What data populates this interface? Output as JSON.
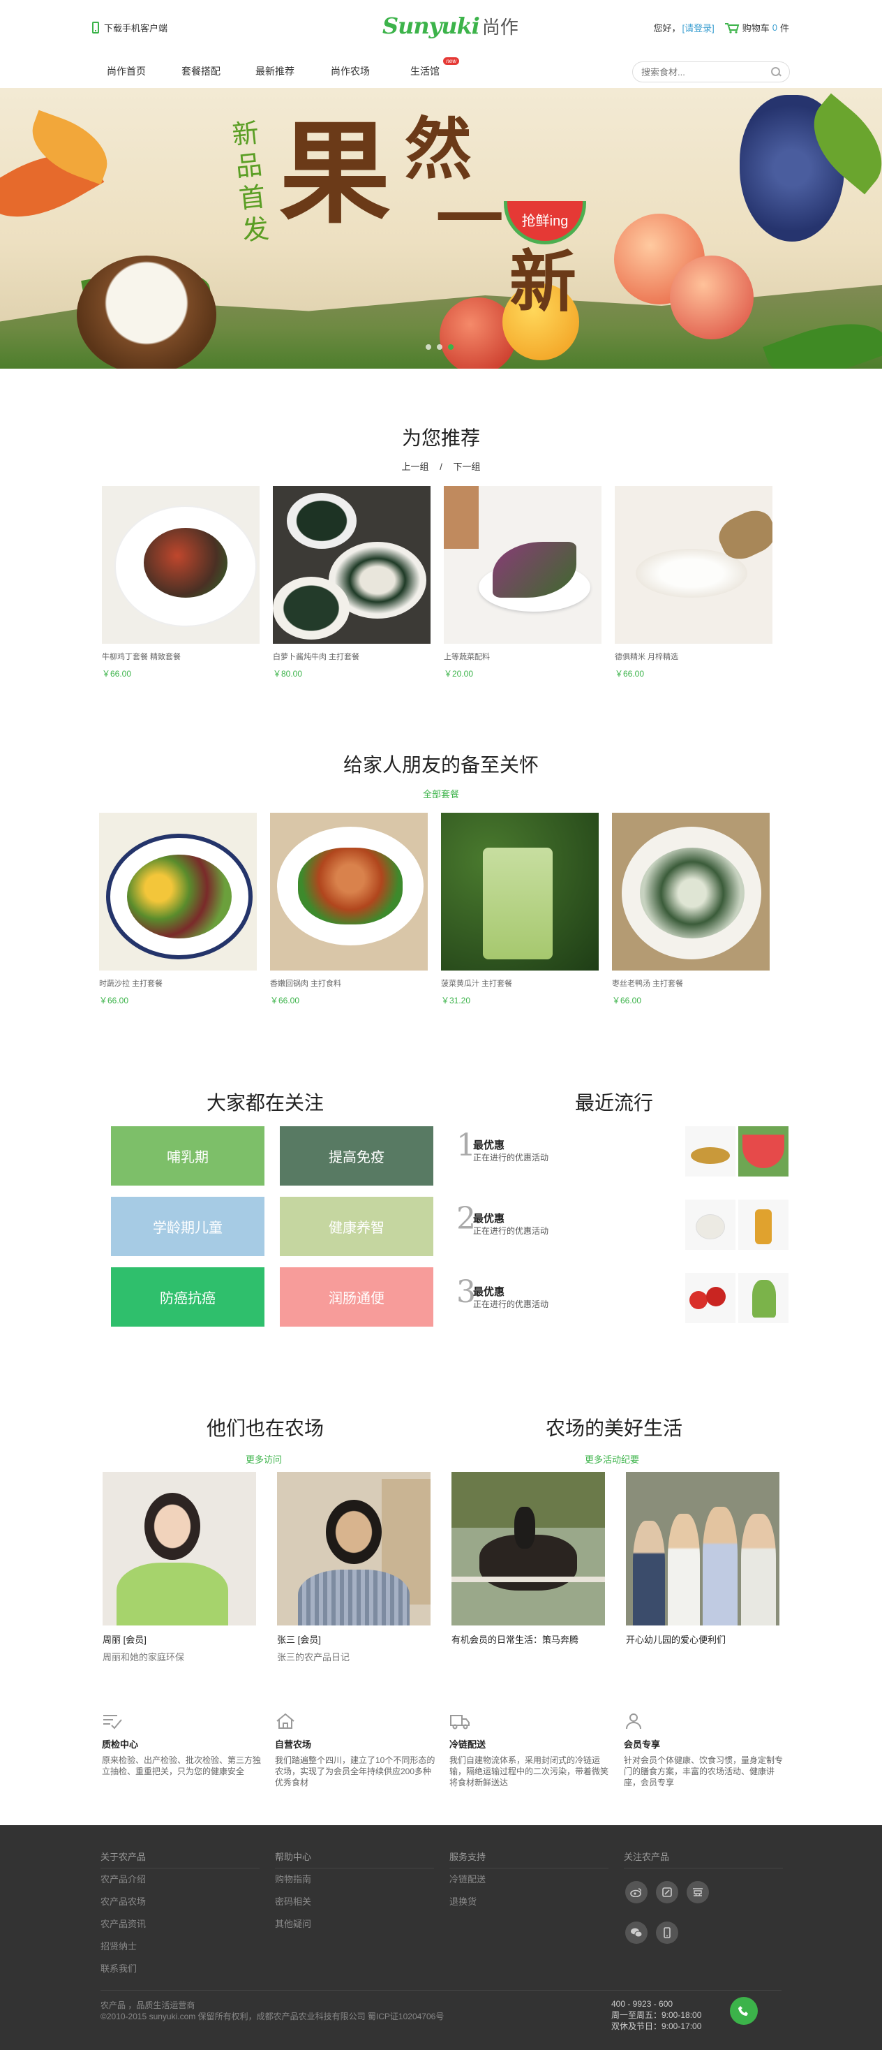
{
  "header": {
    "download_app": "下载手机客户端",
    "logo_en": "Sunyuki",
    "logo_cn": "尚作",
    "greeting": "您好，",
    "login": "[请登录]",
    "cart_label": "购物车",
    "cart_count": "0",
    "cart_unit": "件"
  },
  "nav": {
    "items": [
      "尚作首页",
      "套餐搭配",
      "最新推荐",
      "尚作农场",
      "生活馆"
    ],
    "new_badge": "new",
    "search_placeholder": "搜索食材..."
  },
  "banner": {
    "small_text": "新品首发",
    "big_1": "果",
    "big_2": "然",
    "big_3": "一",
    "big_4": "新",
    "tag": "抢鲜ing"
  },
  "recommend": {
    "title": "为您推荐",
    "prev": "上一组",
    "sep": "/",
    "next": "下一组",
    "items": [
      {
        "name": "牛柳鸡丁套餐  精致套餐",
        "price": "￥66.00"
      },
      {
        "name": "白萝卜酱炖牛肉 主打套餐",
        "price": "￥80.00"
      },
      {
        "name": "上等蔬菜配料",
        "price": "￥20.00"
      },
      {
        "name": "德俱精米  月梓精选",
        "price": "￥66.00"
      }
    ]
  },
  "care": {
    "title": "给家人朋友的备至关怀",
    "all_link": "全部套餐",
    "items": [
      {
        "name": "时蔬沙拉  主打套餐",
        "price": "￥66.00"
      },
      {
        "name": "香嫩回锅肉  主打食料",
        "price": "￥66.00"
      },
      {
        "name": "菠菜黄瓜汁  主打套餐",
        "price": "￥31.20"
      },
      {
        "name": "枣丝老鸭汤  主打套餐",
        "price": "￥66.00"
      }
    ]
  },
  "focus": {
    "title": "大家都在关注",
    "tiles": [
      "哺乳期",
      "提高免疫",
      "学龄期儿童",
      "健康养智",
      "防癌抗癌",
      "润肠通便"
    ]
  },
  "trending": {
    "title": "最近流行",
    "items": [
      {
        "num": "1",
        "title": "最优惠",
        "desc": "正在进行的优惠活动"
      },
      {
        "num": "2",
        "title": "最优惠",
        "desc": "正在进行的优惠活动"
      },
      {
        "num": "3",
        "title": "最优惠",
        "desc": "正在进行的优惠活动"
      }
    ]
  },
  "farmers": {
    "title": "他们也在农场",
    "more": "更多访问",
    "items": [
      {
        "name": "周丽 [会员]",
        "desc": "周丽和她的家庭环保"
      },
      {
        "name": "张三 [会员]",
        "desc": "张三的农产品日记"
      }
    ]
  },
  "farm_life": {
    "title": "农场的美好生活",
    "more": "更多活动纪要",
    "items": [
      {
        "name": "有机会员的日常生活：策马奔腾"
      },
      {
        "name": "开心幼儿园的爱心便利们"
      }
    ]
  },
  "features": [
    {
      "title": "质检中心",
      "desc": "原来检验、出产检验、批次检验、第三方独立抽检、重重把关，只为您的健康安全",
      "icon": "inspection-icon"
    },
    {
      "title": "自营农场",
      "desc": "我们踏遍整个四川，建立了10个不同形态的农场，实现了为会员全年持续供应200多种优秀食材",
      "icon": "farm-house-icon"
    },
    {
      "title": "冷链配送",
      "desc": "我们自建物流体系，采用封闭式的冷链运输，隔绝运输过程中的二次污染，带着微笑将食材新鲜送达",
      "icon": "delivery-truck-icon"
    },
    {
      "title": "会员专享",
      "desc": "针对会员个体健康、饮食习惯，量身定制专门的膳食方案，丰富的农场活动、健康讲座，会员专享",
      "icon": "member-icon"
    }
  ],
  "footer": {
    "col1": [
      "关于农产品",
      "农产品介绍",
      "农产品农场",
      "农产品资讯",
      "招贤纳士",
      "联系我们"
    ],
    "col2": [
      "帮助中心",
      "购物指南",
      "密码相关",
      "其他疑问"
    ],
    "col3": [
      "服务支持",
      "冷链配送",
      "退换货"
    ],
    "col4_title": "关注农产品",
    "socials": [
      "weibo-icon",
      "tencent-weibo-icon",
      "douban-icon",
      "wechat-icon",
      "mobile-icon"
    ],
    "copy_1": "农产品 ，品质生活运营商",
    "copy_2": "©2010-2015 sunyuki.com 保留所有权利，成都农产品农业科技有限公司 蜀ICP证10204706号",
    "phone": "400 - 9923 - 600",
    "hours_1": "周一至周五：9:00-18:00",
    "hours_2": "双休及节日：9:00-17:00"
  },
  "colors": {
    "brand_green": "#3cb34a",
    "link_blue": "#3c9fd1",
    "footer_bg": "#333333"
  }
}
